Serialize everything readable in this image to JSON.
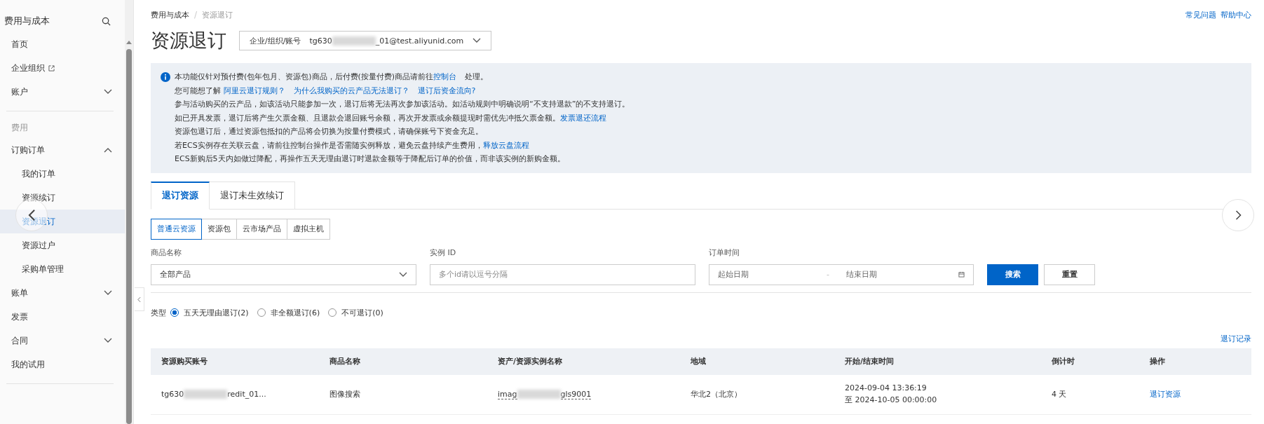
{
  "sidebar": {
    "title": "费用与成本",
    "sections": [
      {
        "items": [
          {
            "label": "首页",
            "kind": "link",
            "selected": false
          },
          {
            "label": "企业组织",
            "kind": "external",
            "selected": false
          },
          {
            "label": "账户",
            "kind": "group",
            "expanded": false,
            "selected": false
          }
        ]
      },
      {
        "heading": "费用",
        "items": [
          {
            "label": "订购订单",
            "kind": "group",
            "expanded": true,
            "selected": false,
            "children": [
              {
                "label": "我的订单",
                "selected": false
              },
              {
                "label": "资源续订",
                "selected": false
              },
              {
                "label": "资源退订",
                "selected": true
              },
              {
                "label": "资源过户",
                "selected": false
              },
              {
                "label": "采购单管理",
                "selected": false
              }
            ]
          },
          {
            "label": "账单",
            "kind": "group",
            "expanded": false,
            "selected": false
          },
          {
            "label": "发票",
            "kind": "link",
            "selected": false
          },
          {
            "label": "合同",
            "kind": "group",
            "expanded": false,
            "selected": false
          },
          {
            "label": "我的试用",
            "kind": "link",
            "selected": false
          }
        ]
      }
    ]
  },
  "breadcrumb": [
    "费用与成本",
    "资源退订"
  ],
  "breadcrumb_separator": "/",
  "help_links": [
    "常见问题",
    "帮助中心"
  ],
  "page_title": "资源退订",
  "account_select": {
    "label": "企业/组织/账号",
    "value_start": "tg630",
    "value_end": "_01@test.aliyunid.com"
  },
  "notice": [
    [
      {
        "text": "本功能仅针对预付费(包年包月、资源包)商品，后付费(按量付费)商品请前往",
        "link": false
      },
      {
        "text": "控制台",
        "link": true
      },
      {
        "text": "处理。",
        "link": false
      }
    ],
    [
      {
        "text": "您可能想了解 ",
        "link": false
      },
      {
        "text": "阿里云退订规则？",
        "link": true
      },
      {
        "text": "为什么我购买的云产品无法退订？",
        "link": true
      },
      {
        "text": "退订后资金流向?",
        "link": true
      }
    ],
    [
      {
        "text": "参与活动购买的云产品，如该活动只能参加一次，退订后将无法再次参加该活动。如活动规则中明确说明“不支持退款”的不支持退订。",
        "link": false
      }
    ],
    [
      {
        "text": "如已开具发票，退订后将产生欠票金额、且退款会退回账号余额，再次开发票或余额提现时需优先冲抵欠票金额。",
        "link": false
      },
      {
        "text": "发票退还流程",
        "link": true
      }
    ],
    [
      {
        "text": "资源包退订后，通过资源包抵扣的产品将会切换为按量付费模式，请确保账号下资金充足。",
        "link": false
      }
    ],
    [
      {
        "text": "若ECS实例存在关联云盘，请前往控制台操作是否需随实例释放，避免云盘持续产生费用，",
        "link": false
      },
      {
        "text": "释放云盘流程",
        "link": true
      }
    ],
    [
      {
        "text": "ECS新购后5天内如做过降配，再操作五天无理由退订时退款金额等于降配后订单的价值，而非该实例的新购金额。",
        "link": false
      }
    ]
  ],
  "tabs": [
    {
      "label": "退订资源",
      "selected": true
    },
    {
      "label": "退订未生效续订",
      "selected": false
    }
  ],
  "subtabs": [
    {
      "label": "普通云资源",
      "selected": true
    },
    {
      "label": "资源包",
      "selected": false
    },
    {
      "label": "云市场产品",
      "selected": false
    },
    {
      "label": "虚拟主机",
      "selected": false
    }
  ],
  "filters": {
    "product": {
      "label": "商品名称",
      "value": "全部产品"
    },
    "instance": {
      "label": "实例 ID",
      "placeholder": "多个id请以逗号分隔"
    },
    "order_time": {
      "label": "订单时间",
      "start_placeholder": "起始日期",
      "range_separator": "-",
      "end_placeholder": "结束日期"
    },
    "search_button": "搜索",
    "reset_button": "重置"
  },
  "type_filter": {
    "label": "类型",
    "options": [
      {
        "label": "五天无理由退订(2)",
        "selected": true
      },
      {
        "label": "非全额退订(6)",
        "selected": false
      },
      {
        "label": "不可退订(0)",
        "selected": false
      }
    ]
  },
  "record_link": "退订记录",
  "table": {
    "columns": [
      "资源购买账号",
      "商品名称",
      "资产/资源实例名称",
      "地域",
      "开始/结束时间",
      "倒计时",
      "操作"
    ],
    "rows": [
      {
        "account_start": "tg630",
        "account_end": "redit_01...",
        "product": "图像搜索",
        "instance_start": "imag",
        "instance_end": "gls9001",
        "region": "华北2（北京）",
        "start_time": "2024-09-04 13:36:19",
        "end_time": "至 2024-10-05 00:00:00",
        "countdown": "4 天",
        "action": "退订资源"
      }
    ]
  }
}
